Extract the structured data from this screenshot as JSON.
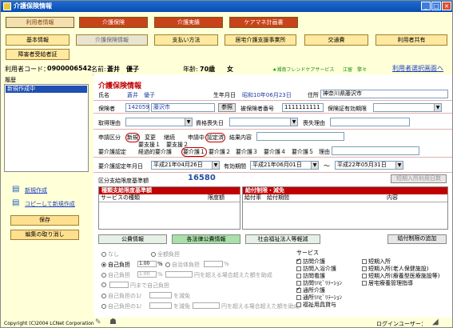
{
  "window": {
    "title": "介護保険情報"
  },
  "nav1": [
    {
      "label": "利用者情報",
      "active": true
    },
    {
      "label": "介護保険",
      "active": false
    },
    {
      "label": "介護実績",
      "active": false
    },
    {
      "label": "ケアマネ計画書",
      "active": false
    }
  ],
  "nav2": [
    {
      "label": "基本情報"
    },
    {
      "label": "介護保険情報"
    },
    {
      "label": "支払い方法"
    },
    {
      "label": "居宅介護支援事業所"
    },
    {
      "label": "交通費"
    },
    {
      "label": "利用者共有"
    },
    {
      "label": "障害者受給者証"
    }
  ],
  "user": {
    "id_label": "利用者コード：",
    "id": "0900006542",
    "name_label": "名前:",
    "name": "蒼井　優子",
    "age_label": "年齢:",
    "age": "70歳",
    "gender": "女",
    "office": "★湘南フレンドケアサービス",
    "staff": "江留　擎々",
    "select_link": "利用者選択画面へ"
  },
  "sidebar": {
    "history_label": "履歴",
    "history_selected": "新規作成中",
    "new_create": "新規作成",
    "copy_create": "コピーして新規作成",
    "save": "保存",
    "cancel_edit": "編集の取り消し"
  },
  "form": {
    "section_title": "介護保険情報",
    "name_label": "氏名",
    "name_value": "蒼井　優子",
    "birth_label": "生年月日",
    "birth_value": "昭和10年06月23日",
    "address_label": "住所",
    "address_value": "神奈川県藤沢市",
    "insurer_label": "保険者",
    "insurer_code": "142059",
    "insurer_city": "藤沢市",
    "ref_btn": "参照",
    "insured_no_label": "被保険者番号",
    "insured_no": "1111111111",
    "cert_label": "保険証有効期限",
    "acquire_reason_label": "取得理由",
    "qualify_date_label": "資格喪失日",
    "loss_reason_label": "喪失理由",
    "apply_label": "申請区分",
    "apply_opts": [
      "新規",
      "変更",
      "継続"
    ],
    "apply_status_label": "申請中",
    "apply_status_val": "認定済",
    "result_label": "結果内容",
    "care_label": "要介護認定",
    "support_row": "要支援１　要支援２",
    "care_opts": [
      "経過的要介護",
      "要介護１",
      "要介護２",
      "要介護３",
      "要介護４",
      "要介護５"
    ],
    "reason_label": "理由",
    "cert_date_label": "要介護認定年月日",
    "cert_date": "平成21年04月26日",
    "valid_label": "有効期間",
    "valid_from": "平成21年06月01日",
    "valid_sep": "～",
    "valid_to": "平成22年05月31日",
    "limit_label": "区分支給限度基準額",
    "limit_value": "16580",
    "short_stay_btn": "短期入所利用日数",
    "panel_left_title": "種類支給限度基準額",
    "panel_left_cols": [
      "サービスの種類",
      "限度額"
    ],
    "panel_right_title": "給付制限・減免",
    "panel_right_cols": [
      "給付率",
      "給付期間",
      "内容"
    ]
  },
  "tabs": [
    {
      "label": "公費情報",
      "active": false
    },
    {
      "label": "各法律公費情報",
      "active": true
    },
    {
      "label": "社会福祉法人等軽減",
      "active": false
    }
  ],
  "limit_add_btn": "給付制限の追加",
  "burden": {
    "none": "なし",
    "full": "全額負担",
    "self_label": "自己負担",
    "self_rate": "1.00",
    "pct": "%",
    "self_rate2": "1.00",
    "other_pct_label": "自治体負担",
    "over_text": "円を超える場合超えた額を助成",
    "yen_fixed": "円まで自己負担",
    "burden_1": "自己負担の1/",
    "reduce": "を減免",
    "ru_over": "円を超える場合超えた額を助成"
  },
  "services": {
    "title": "サービス",
    "left": [
      {
        "label": "訪問介護",
        "checked": true
      },
      {
        "label": "訪問入浴介護",
        "checked": false
      },
      {
        "label": "訪問看護",
        "checked": false
      },
      {
        "label": "訪問ﾘﾊﾋﾞﾘﾃｰｼｮﾝ",
        "checked": false
      },
      {
        "label": "通所介護",
        "checked": true
      },
      {
        "label": "通所ﾘﾊﾋﾞﾘﾃｰｼｮﾝ",
        "checked": false
      },
      {
        "label": "福祉用具貸与",
        "checked": false
      }
    ],
    "right": [
      {
        "label": "短期入所",
        "checked": false
      },
      {
        "label": "短期入所(老人保健施設)",
        "checked": false
      },
      {
        "label": "短期入所(療養型医療施設等)",
        "checked": false
      },
      {
        "label": "居宅療養管理指導",
        "checked": false
      }
    ]
  },
  "status": {
    "copyright": "Copyright (C)2004 LCNet Corporation",
    "login_label": "ログインユーザー："
  }
}
